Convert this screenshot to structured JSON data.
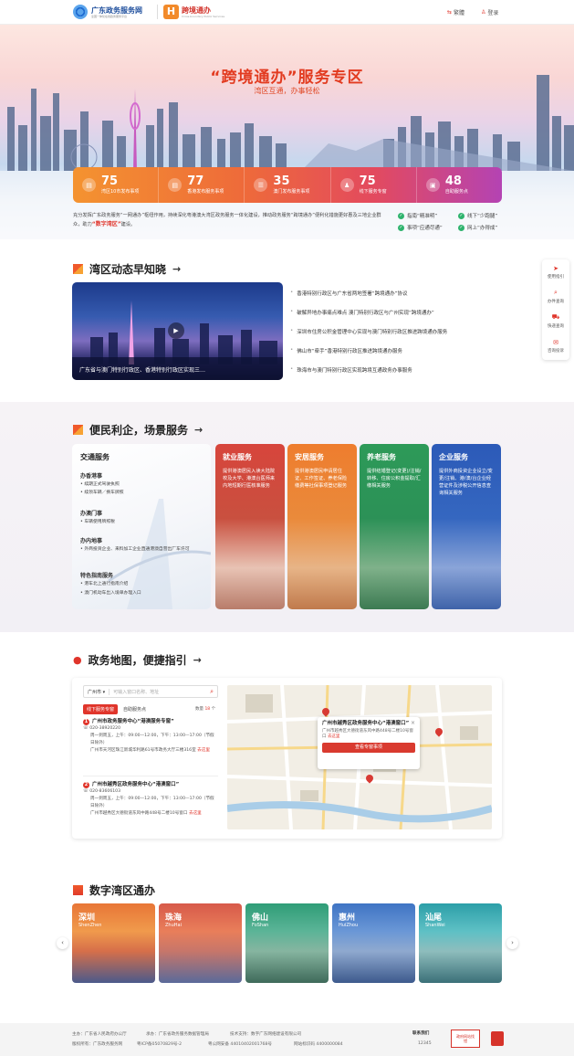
{
  "header": {
    "logo1_title": "广东政务服务网",
    "logo1_sub": "全国一体化在线政务服务平台",
    "logo2_title": "跨境通办",
    "logo2_sub": "Cross-boundary Public Services",
    "lang_label": "繁體",
    "login_label": "登录"
  },
  "hero": {
    "title": "“跨境通办”服务专区",
    "subtitle": "湾区互通，办事轻松",
    "stats": [
      {
        "num": "75",
        "label": "湾区10市发布事项"
      },
      {
        "num": "77",
        "label": "香港发布服务事项"
      },
      {
        "num": "35",
        "label": "澳门发布服务事项"
      },
      {
        "num": "75",
        "label": "线下服务专窗"
      },
      {
        "num": "48",
        "label": "自助服务点"
      }
    ],
    "intro_text": "充分发挥广东政务服务“一网通办”枢纽作用，持续深化粤港澳大湾区政务服务一体化建设，推动政务服务“跨境通办”便利化措施更好惠及三地企业群众，助力",
    "intro_highlight": "“数字湾区”",
    "intro_tail": "建设。",
    "checks": [
      "指南“精准明”",
      "线下“少跑腿”",
      "事项“应通尽通”",
      "网上“办得成”"
    ]
  },
  "news": {
    "title": "湾区动态早知晓",
    "video_caption": "广东省与澳门特别行政区、香港特别行政区实现三…",
    "items": [
      "香港特别行政区与广东省两地签署“跨境通办”协议",
      "破解异地办事痛点难点 澳门特别行政区与广州实现“跨境通办”",
      "深圳市住房公积金管理中心实现与澳门特别行政区推进跨境通办服务",
      "佛山市“牵手”香港特别行政区推进跨境通办服务",
      "珠海市与澳门特别行政区实现跨境互通政务办事服务"
    ]
  },
  "tools": [
    {
      "icon": "send-icon",
      "label": "使用指引"
    },
    {
      "icon": "search-icon",
      "label": "办件查询"
    },
    {
      "icon": "truck-icon",
      "label": "快递查询"
    },
    {
      "icon": "chat-icon",
      "label": "咨询投诉"
    }
  ],
  "services": {
    "title": "便民利企，场景服务",
    "traffic_title": "交通服务",
    "groups": [
      {
        "title": "办香港事",
        "items": [
          "续期正式驾驶执照",
          "续领车辆／换车牌照"
        ]
      },
      {
        "title": "办澳门事",
        "items": [
          "车辆使用牌照税"
        ]
      },
      {
        "title": "办内地事",
        "items": [
          "外商投资企业、来料加工企业直通港澳自营出厂车许可"
        ]
      },
      {
        "title": "特色指南服务",
        "items": [
          "港车北上通行指南介绍",
          "澳门机动车出入境单办理入口"
        ]
      }
    ],
    "cards": [
      {
        "title": "就业服务",
        "desc": "提供港澳居民入读大陆院校及大学、港澳台医师来内地短期行医核准服务"
      },
      {
        "title": "安居服务",
        "desc": "提供港澳居民申请居住证、工作签证、养老保险缴费等社保事项登记服务"
      },
      {
        "title": "养老服务",
        "desc": "提供结婚登记(变更)/注销/转移、住房公积金提取/汇缴相关服务"
      },
      {
        "title": "企业服务",
        "desc": "提供外商投资企业设立/变更/注销、港/澳/台企业经营证件及涉税公开信息查询相关服务"
      }
    ]
  },
  "map": {
    "title": "政务地图，便捷指引",
    "city": "广州市",
    "search_placeholder": "可输入窗口名称、地址",
    "tab_active": "线下服务专窗",
    "tab_other": "自助服务点",
    "count_label": "数量",
    "count": "18",
    "count_unit": "个",
    "offices": [
      {
        "no": "1",
        "name": "广州市政务服务中心“港澳服务专窗”",
        "phone": "020-38920220",
        "hours": "周一到周五，上午：09:00—12:00，下午：13:00—17:00（节假日除外）",
        "addr": "广州市天河区珠江新城华利路61号市政务大厅三楼316室",
        "go": "去这里"
      },
      {
        "no": "2",
        "name": "广州市越秀区政务服务中心“港澳窗口”",
        "phone": "020-83606103",
        "hours": "周一到周五，上午：09:00—12:00，下午：13:00—17:00（节假日除外）",
        "addr": "广州市越秀区大德街道东风中路448号二楼10号窗口",
        "go": "去这里"
      }
    ],
    "popup_title": "广州市越秀区政务服务中心“港澳窗口”",
    "popup_addr": "广州市越秀区大德街道东风中路448号二楼10号窗口",
    "popup_go": "去这里",
    "popup_button": "查看专窗事项"
  },
  "digital": {
    "title": "数字湾区通办",
    "cities": [
      {
        "name": "深圳",
        "en": "ShenZhen"
      },
      {
        "name": "珠海",
        "en": "ZhuHai"
      },
      {
        "name": "佛山",
        "en": "FoShan"
      },
      {
        "name": "惠州",
        "en": "HuiZhou"
      },
      {
        "name": "汕尾",
        "en": "ShanWei"
      }
    ]
  },
  "footer": {
    "line1a": "主办：广东省人民政府办公厅",
    "line1b": "承办：广东省政务服务数据管理局",
    "line1c": "技术支持：数字广东网络建设有限公司",
    "line2a": "版权所有：广东政务服务网",
    "line2b": "粤ICP备05070829号-2",
    "line2c": "粤公网安备 44010402001768号",
    "line2d": "网站标识码 4400000084",
    "contact_label": "联系我们",
    "contact_num": "12345",
    "badge": "政府网站找错"
  },
  "colors": {
    "accent": "#e0352b",
    "orange": "#f49330",
    "purple": "#b443b3"
  }
}
